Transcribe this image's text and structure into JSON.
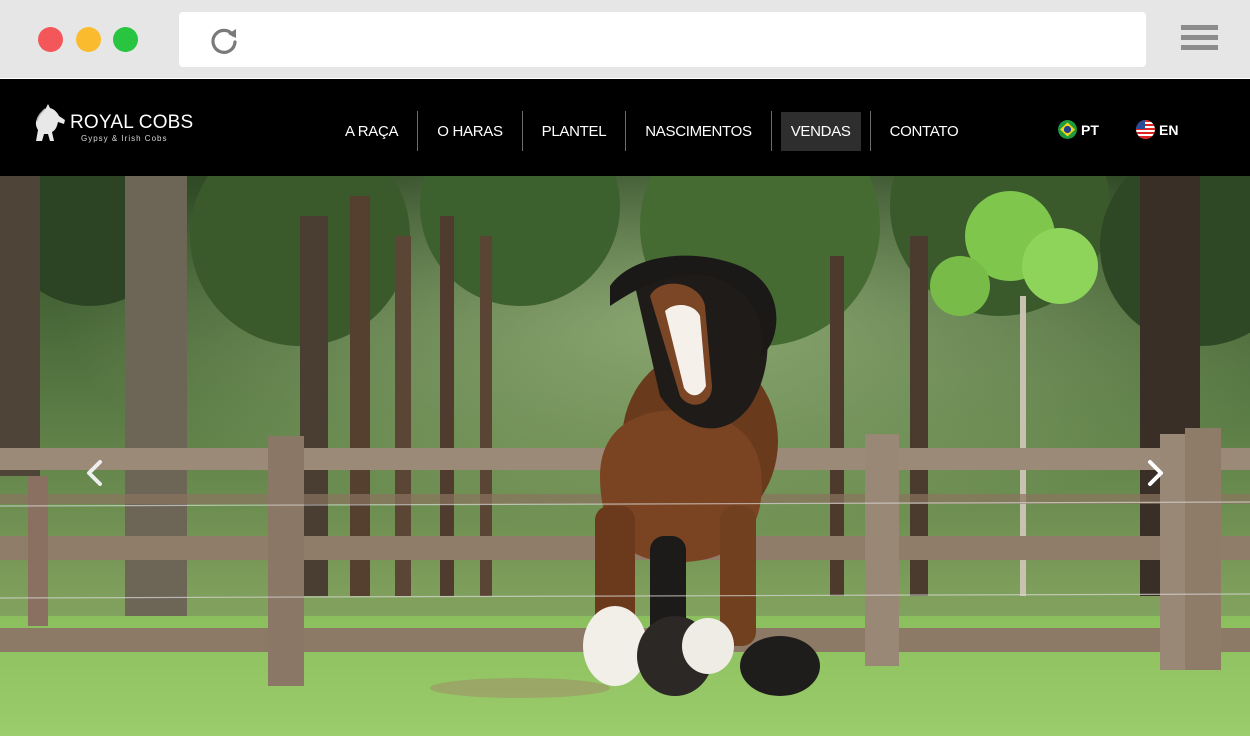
{
  "browser": {
    "colors": {
      "close": "#f4575a",
      "minimize": "#fbbb2e",
      "maximize": "#29c440"
    },
    "url": "",
    "icons": {
      "reload": "reload-icon",
      "menu": "hamburger-menu-icon"
    }
  },
  "site": {
    "logo": {
      "title": "ROYAL COBS",
      "subtitle": "Gypsy & Irish Cobs",
      "icon": "horse-logo-icon"
    },
    "nav": [
      {
        "label": "A RAÇA",
        "active": false
      },
      {
        "label": "O HARAS",
        "active": false
      },
      {
        "label": "PLANTEL",
        "active": false
      },
      {
        "label": "NASCIMENTOS",
        "active": false
      },
      {
        "label": "VENDAS",
        "active": true
      },
      {
        "label": "CONTATO",
        "active": false
      }
    ],
    "languages": [
      {
        "code": "PT",
        "flag": "brazil-flag-icon"
      },
      {
        "code": "EN",
        "flag": "usa-flag-icon"
      }
    ],
    "colors": {
      "header_bg": "#000000",
      "active_bg": "#2e2e2e"
    }
  },
  "hero": {
    "image": "Gypsy cob horse galloping in a fenced paddock with trees",
    "icons": {
      "prev": "chevron-left-icon",
      "next": "chevron-right-icon"
    }
  }
}
